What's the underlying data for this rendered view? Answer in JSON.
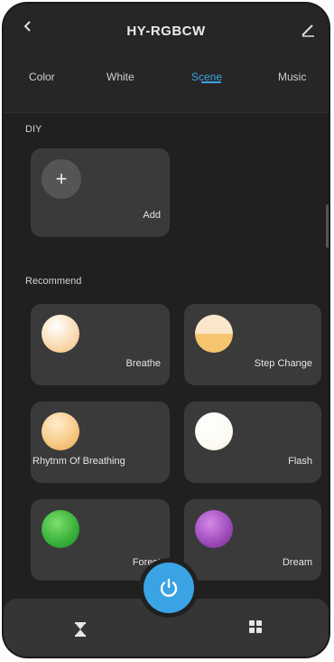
{
  "header": {
    "title": "HY-RGBCW",
    "back_icon": "chevron-left-icon",
    "edit_icon": "pencil-icon"
  },
  "tabs": [
    {
      "label": "Color",
      "active": false
    },
    {
      "label": "White",
      "active": false
    },
    {
      "label": "Scene",
      "active": true
    },
    {
      "label": "Music",
      "active": false
    }
  ],
  "diy": {
    "section_label": "DIY",
    "add_label": "Add",
    "add_icon": "plus-icon"
  },
  "recommend": {
    "section_label": "Recommend",
    "scenes": [
      {
        "label": "Breathe",
        "colors": [
          "#ffffff",
          "#f6c98a"
        ]
      },
      {
        "label": "Step Change",
        "colors": [
          "#fbe6c6",
          "#f5c56e"
        ]
      },
      {
        "label": "Rhytnm Of Breathing",
        "colors": [
          "#ffe9c2",
          "#f3b15d"
        ]
      },
      {
        "label": "Flash",
        "colors": [
          "#ffffff",
          "#fdf1e3"
        ]
      },
      {
        "label": "Forest",
        "colors": [
          "#6ad45c",
          "#1f8f2e"
        ]
      },
      {
        "label": "Dream",
        "colors": [
          "#c07ad6",
          "#7a2f92"
        ]
      }
    ]
  },
  "bottom": {
    "timer_icon": "hourglass-icon",
    "power_icon": "power-icon",
    "grid_icon": "grid-icon"
  },
  "colors": {
    "accent": "#3aa3e4",
    "background": "#202020",
    "card": "#3a3a3a"
  }
}
